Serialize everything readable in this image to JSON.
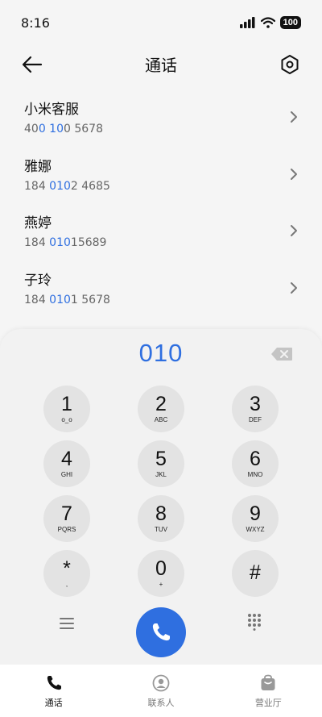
{
  "status_bar": {
    "time": "8:16",
    "battery": "100"
  },
  "header": {
    "title": "通话"
  },
  "contacts": [
    {
      "name": "小米客服",
      "number_pre": "40",
      "number_hl": "0 10",
      "number_post": "0 5678"
    },
    {
      "name": "雅娜",
      "number_pre": "184 ",
      "number_hl": "010",
      "number_post": "2 4685"
    },
    {
      "name": "燕婷",
      "number_pre": "184 ",
      "number_hl": "010",
      "number_post": "15689"
    },
    {
      "name": "子玲",
      "number_pre": "184 ",
      "number_hl": "010",
      "number_post": "1 5678"
    }
  ],
  "dialpad": {
    "display": "010",
    "keys": [
      {
        "digit": "1",
        "letters": "o_o"
      },
      {
        "digit": "2",
        "letters": "ABC"
      },
      {
        "digit": "3",
        "letters": "DEF"
      },
      {
        "digit": "4",
        "letters": "GHI"
      },
      {
        "digit": "5",
        "letters": "JKL"
      },
      {
        "digit": "6",
        "letters": "MNO"
      },
      {
        "digit": "7",
        "letters": "PQRS"
      },
      {
        "digit": "8",
        "letters": "TUV"
      },
      {
        "digit": "9",
        "letters": "WXYZ"
      },
      {
        "digit": "*",
        "letters": ","
      },
      {
        "digit": "0",
        "letters": "+"
      },
      {
        "digit": "#",
        "letters": ""
      }
    ]
  },
  "tabs": [
    {
      "label": "通话",
      "icon": "phone-icon",
      "active": true
    },
    {
      "label": "联系人",
      "icon": "contacts-icon",
      "active": false
    },
    {
      "label": "营业厅",
      "icon": "store-icon",
      "active": false
    }
  ],
  "colors": {
    "accent": "#2f6fe0",
    "key_bg": "#e3e3e3",
    "sheet_bg": "#f2f2f2"
  }
}
